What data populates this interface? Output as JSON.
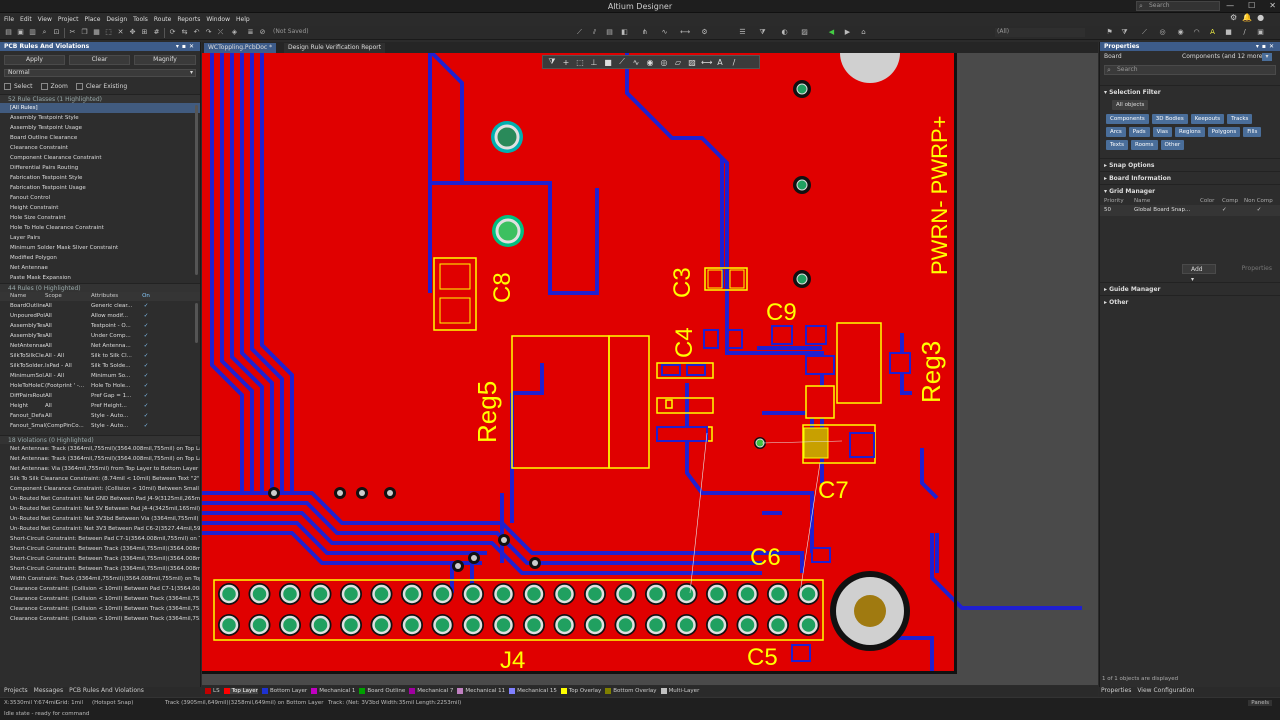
{
  "app": {
    "title": "Altium Designer",
    "search_placeholder": "Search"
  },
  "menu": [
    "File",
    "Edit",
    "View",
    "Project",
    "Place",
    "Design",
    "Tools",
    "Route",
    "Reports",
    "Window",
    "Help"
  ],
  "toolbar": {
    "not_saved": "(Not Saved)",
    "filter_combo": "(All)"
  },
  "left": {
    "title": "PCB Rules And Violations",
    "apply": "Apply",
    "clear": "Clear",
    "magnify": "Magnify",
    "mode": "Normal",
    "select": "Select",
    "zoom": "Zoom",
    "clear_existing": "Clear Existing",
    "classes_header": "52 Rule Classes (1 Highlighted)",
    "classes": [
      "[All Rules]",
      "Assembly Testpoint Style",
      "Assembly Testpoint Usage",
      "Board Outline Clearance",
      "Clearance Constraint",
      "Component Clearance Constraint",
      "Differential Pairs Routing",
      "Fabrication Testpoint Style",
      "Fabrication Testpoint Usage",
      "Fanout Control",
      "Height Constraint",
      "Hole Size Constraint",
      "Hole To Hole Clearance Constraint",
      "Layer Pairs",
      "Minimum Solder Mask Sliver Constraint",
      "Modified Polygon",
      "Net Antennae",
      "Paste Mask Expansion"
    ],
    "rules_header": "44 Rules (0 Highlighted)",
    "rules_cols": [
      "Name",
      "Scope",
      "Attributes",
      "On"
    ],
    "rules": [
      [
        "BoardOutline...",
        "All",
        "Generic clear...",
        "✓"
      ],
      [
        "UnpouredPol...",
        "All",
        "Allow modif...",
        "✓"
      ],
      [
        "AssemblyTes...",
        "All",
        "Testpoint - O...",
        "✓"
      ],
      [
        "AssemblyTes...",
        "All",
        "Under Comp...",
        "✓"
      ],
      [
        "NetAntennae",
        "All",
        "Net Antenna...",
        "✓"
      ],
      [
        "SilkToSilkCle...",
        "All - All",
        "Silk to Silk Cl...",
        "✓"
      ],
      [
        "SilkToSolder...",
        "IsPad - All",
        "Silk To Solde...",
        "✓"
      ],
      [
        "MinimumSol...",
        "All - All",
        "Minimum So...",
        "✓"
      ],
      [
        "HoleToHoleC...",
        "(Footprint ' -...",
        "Hole To Hole...",
        "✓"
      ],
      [
        "DiffPairsRout...",
        "All",
        "Pref Gap = 1...",
        "✓"
      ],
      [
        "Height",
        "All",
        "Pref Height...",
        "✓"
      ],
      [
        "Fanout_Defa...",
        "All",
        "Style - Auto...",
        "✓"
      ],
      [
        "Fanout_Small",
        "(CompPinCo...",
        "Style - Auto...",
        "✓"
      ]
    ],
    "violations_header": "18 Violations (0 Highlighted)",
    "violations": [
      "Net Antennae: Track (3364mil,755mil)(3564.008mil,755mil) on Top Layer",
      "Net Antennae: Track (3364mil,755mil)(3564.008mil,755mil) on Top Layer",
      "Net Antennae: Via (3364mil,755mil) from Top Layer to Bottom Layer",
      "Silk To Silk Clearance Constraint: (8.74mil < 10mil) Between Text \"2\" (362...",
      "Component Clearance Constraint: (Collision < 10mil) Between Small Com...",
      "Un-Routed Net Constraint: Net GND Between Pad J4-9(3125mil,265mil) o...",
      "Un-Routed Net Constraint: Net 5V Between Pad J4-4(3425mil,165mil) on...",
      "Un-Routed Net Constraint: Net 3V3bd Between Via (3364mil,755mil) fro...",
      "Un-Routed Net Constraint: Net 3V3 Between Pad C6-2(3527.44mil,590mil...",
      "Short-Circuit Constraint: Between Pad C7-1(3564.008mil,755mil) on To...",
      "Short-Circuit Constraint: Between Track (3364mil,755mil)(3564.008mil,75...",
      "Short-Circuit Constraint: Between Track (3364mil,755mil)(3564.008mil,75...",
      "Short-Circuit Constraint: Between Track (3364mil,755mil)(3564.008mil,75...",
      "Width Constraint: Track (3364mil,755mil)(3564.008mil,755mil) on Top Lay...",
      "Clearance Constraint: (Collision < 10mil) Between Pad C7-1(3564.008mil,...",
      "Clearance Constraint: (Collision < 10mil) Between Track (3364mil,755mil)...",
      "Clearance Constraint: (Collision < 10mil) Between Track (3364mil,755mil)...",
      "Clearance Constraint: (Collision < 10mil) Between Track (3364mil,755mil)..."
    ],
    "bottom_tabs": [
      "Projects",
      "Messages",
      "PCB Rules And Violations"
    ]
  },
  "tabs": [
    "WCToppling.PcbDoc *",
    "Design Rule Verification Report"
  ],
  "board": {
    "labels": {
      "PWRN": "PWRN- PWRP+",
      "C8": "C8",
      "C3": "C3",
      "C4": "C4",
      "C9": "C9",
      "REG5": "Reg5",
      "REG3": "Reg3",
      "C7": "C7",
      "C6": "C6",
      "J4": "J4",
      "C5": "C5"
    }
  },
  "layers": [
    {
      "name": "LS",
      "color": "#c00000"
    },
    {
      "name": "Top Layer",
      "color": "#ff0000"
    },
    {
      "name": "Bottom Layer",
      "color": "#1e32d0"
    },
    {
      "name": "Mechanical 1",
      "color": "#c000c0"
    },
    {
      "name": "Board Outline",
      "color": "#00a000"
    },
    {
      "name": "Mechanical 7",
      "color": "#a000a0"
    },
    {
      "name": "Mechanical 11",
      "color": "#c080c0"
    },
    {
      "name": "Mechanical 15",
      "color": "#8080ff"
    },
    {
      "name": "Top Overlay",
      "color": "#ffff00"
    },
    {
      "name": "Bottom Overlay",
      "color": "#808000"
    },
    {
      "name": "Multi-Layer",
      "color": "#c0c0c0"
    }
  ],
  "right": {
    "title": "Properties",
    "board": "Board",
    "components": "Components (and 12 more)",
    "search": "Search",
    "selection_filter": "Selection Filter",
    "all_objects": "All objects",
    "chips": [
      "Components",
      "3D Bodies",
      "Keepouts",
      "Tracks",
      "Arcs",
      "Pads",
      "Vias",
      "Regions",
      "Polygons",
      "Fills",
      "Texts",
      "Rooms",
      "Other"
    ],
    "snap_options": "Snap Options",
    "board_information": "Board Information",
    "grid_manager": "Grid Manager",
    "grid_cols": [
      "Priority",
      "Name",
      "Color",
      "Comp",
      "Non Comp"
    ],
    "grid_row": [
      "50",
      "Global Board Snap...",
      "",
      "✓",
      "✓"
    ],
    "add": "Add",
    "properties_btn": "Properties",
    "guide_manager": "Guide Manager",
    "other": "Other",
    "objects_displayed": "1 of 1 objects are displayed",
    "bottom_tabs": [
      "Properties",
      "View Configuration"
    ]
  },
  "status": {
    "coords": "X:3530mil Y:674mil",
    "grid": "Grid: 1mil",
    "snap": "(Hotspot Snap)",
    "track": "Track (3905mil,649mil)(3258mil,649mil) on Bottom Layer",
    "net": "Track: (Net: 3V3bd Width:35mil Length:2253mil)",
    "idle": "Idle state - ready for command",
    "panels": "Panels"
  }
}
